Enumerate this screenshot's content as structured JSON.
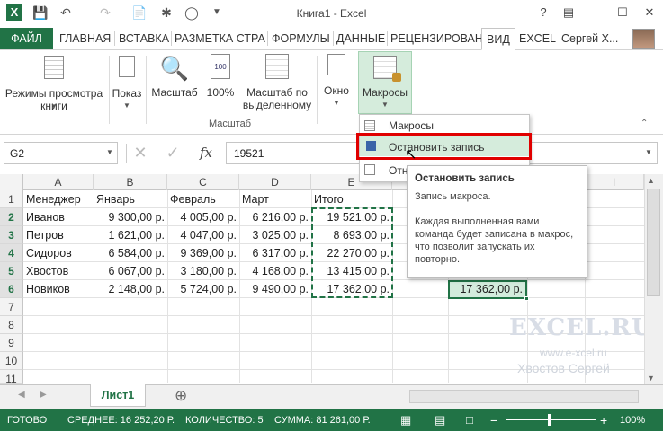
{
  "window": {
    "title": "Книга1 - Excel",
    "user": "Сергей Х..."
  },
  "tabs": [
    {
      "label": "ФАЙЛ"
    },
    {
      "label": "ГЛАВНАЯ"
    },
    {
      "label": "ВСТАВКА"
    },
    {
      "label": "РАЗМЕТКА СТРА"
    },
    {
      "label": "ФОРМУЛЫ"
    },
    {
      "label": "ДАННЫЕ"
    },
    {
      "label": "РЕЦЕНЗИРОВАН"
    },
    {
      "label": "ВИД"
    },
    {
      "label": "EXCEL"
    }
  ],
  "ribbon": {
    "view_modes": "Режимы просмотра\nкниги",
    "show": "Показ",
    "zoom": "Масштаб",
    "zoom100": "100%",
    "zoom_sel": "Масштаб по\nвыделенному",
    "zoom_group": "Масштаб",
    "window": "Окно",
    "macros": "Макросы"
  },
  "formula": {
    "name_box": "G2",
    "fx": "fx",
    "value": "19521"
  },
  "columns": [
    "A",
    "B",
    "C",
    "D",
    "E",
    "F",
    "G",
    "H",
    "I"
  ],
  "rows": [
    "1",
    "2",
    "3",
    "4",
    "5",
    "6",
    "7",
    "8",
    "9",
    "10",
    "11"
  ],
  "table": {
    "header": [
      "Менеджер",
      "Январь",
      "Февраль",
      "Март",
      "Итого"
    ],
    "data": [
      [
        "Иванов",
        "9 300,00 р.",
        "4 005,00 р.",
        "6 216,00 р.",
        "19 521,00 р."
      ],
      [
        "Петров",
        "1 621,00 р.",
        "4 047,00 р.",
        "3 025,00 р.",
        "8 693,00 р."
      ],
      [
        "Сидоров",
        "6 584,00 р.",
        "9 369,00 р.",
        "6 317,00 р.",
        "22 270,00 р."
      ],
      [
        "Хвостов",
        "6 067,00 р.",
        "3 180,00 р.",
        "4 168,00 р.",
        "13 415,00 р."
      ],
      [
        "Новиков",
        "2 148,00 р.",
        "5 724,00 р.",
        "9 490,00 р.",
        "17 362,00 р."
      ]
    ],
    "g6": "17 362,00 р."
  },
  "dropdown": {
    "item1": "Макросы",
    "item2": "Остановить запись",
    "item3": "Отн"
  },
  "tooltip": {
    "title": "Остановить запись",
    "line1": "Запись макроса.",
    "body": "Каждая выполненная вами команда будет записана в макрос, что позволит запускать их повторно."
  },
  "watermark": {
    "logo": "EXCEL.RU",
    "url": "www.e-xcel.ru",
    "author": "Хвостов Сергей"
  },
  "sheet": {
    "tab": "Лист1",
    "add": "⊕"
  },
  "status": {
    "ready": "ГОТОВО",
    "avg": "СРЕДНЕЕ:  16 252,20 Р.",
    "count": "КОЛИЧЕСТВО: 5",
    "sum": "СУММА:  81 261,00 Р.",
    "zoom": "100%"
  },
  "colors": {
    "accent": "#217346",
    "highlight": "#e00000"
  }
}
